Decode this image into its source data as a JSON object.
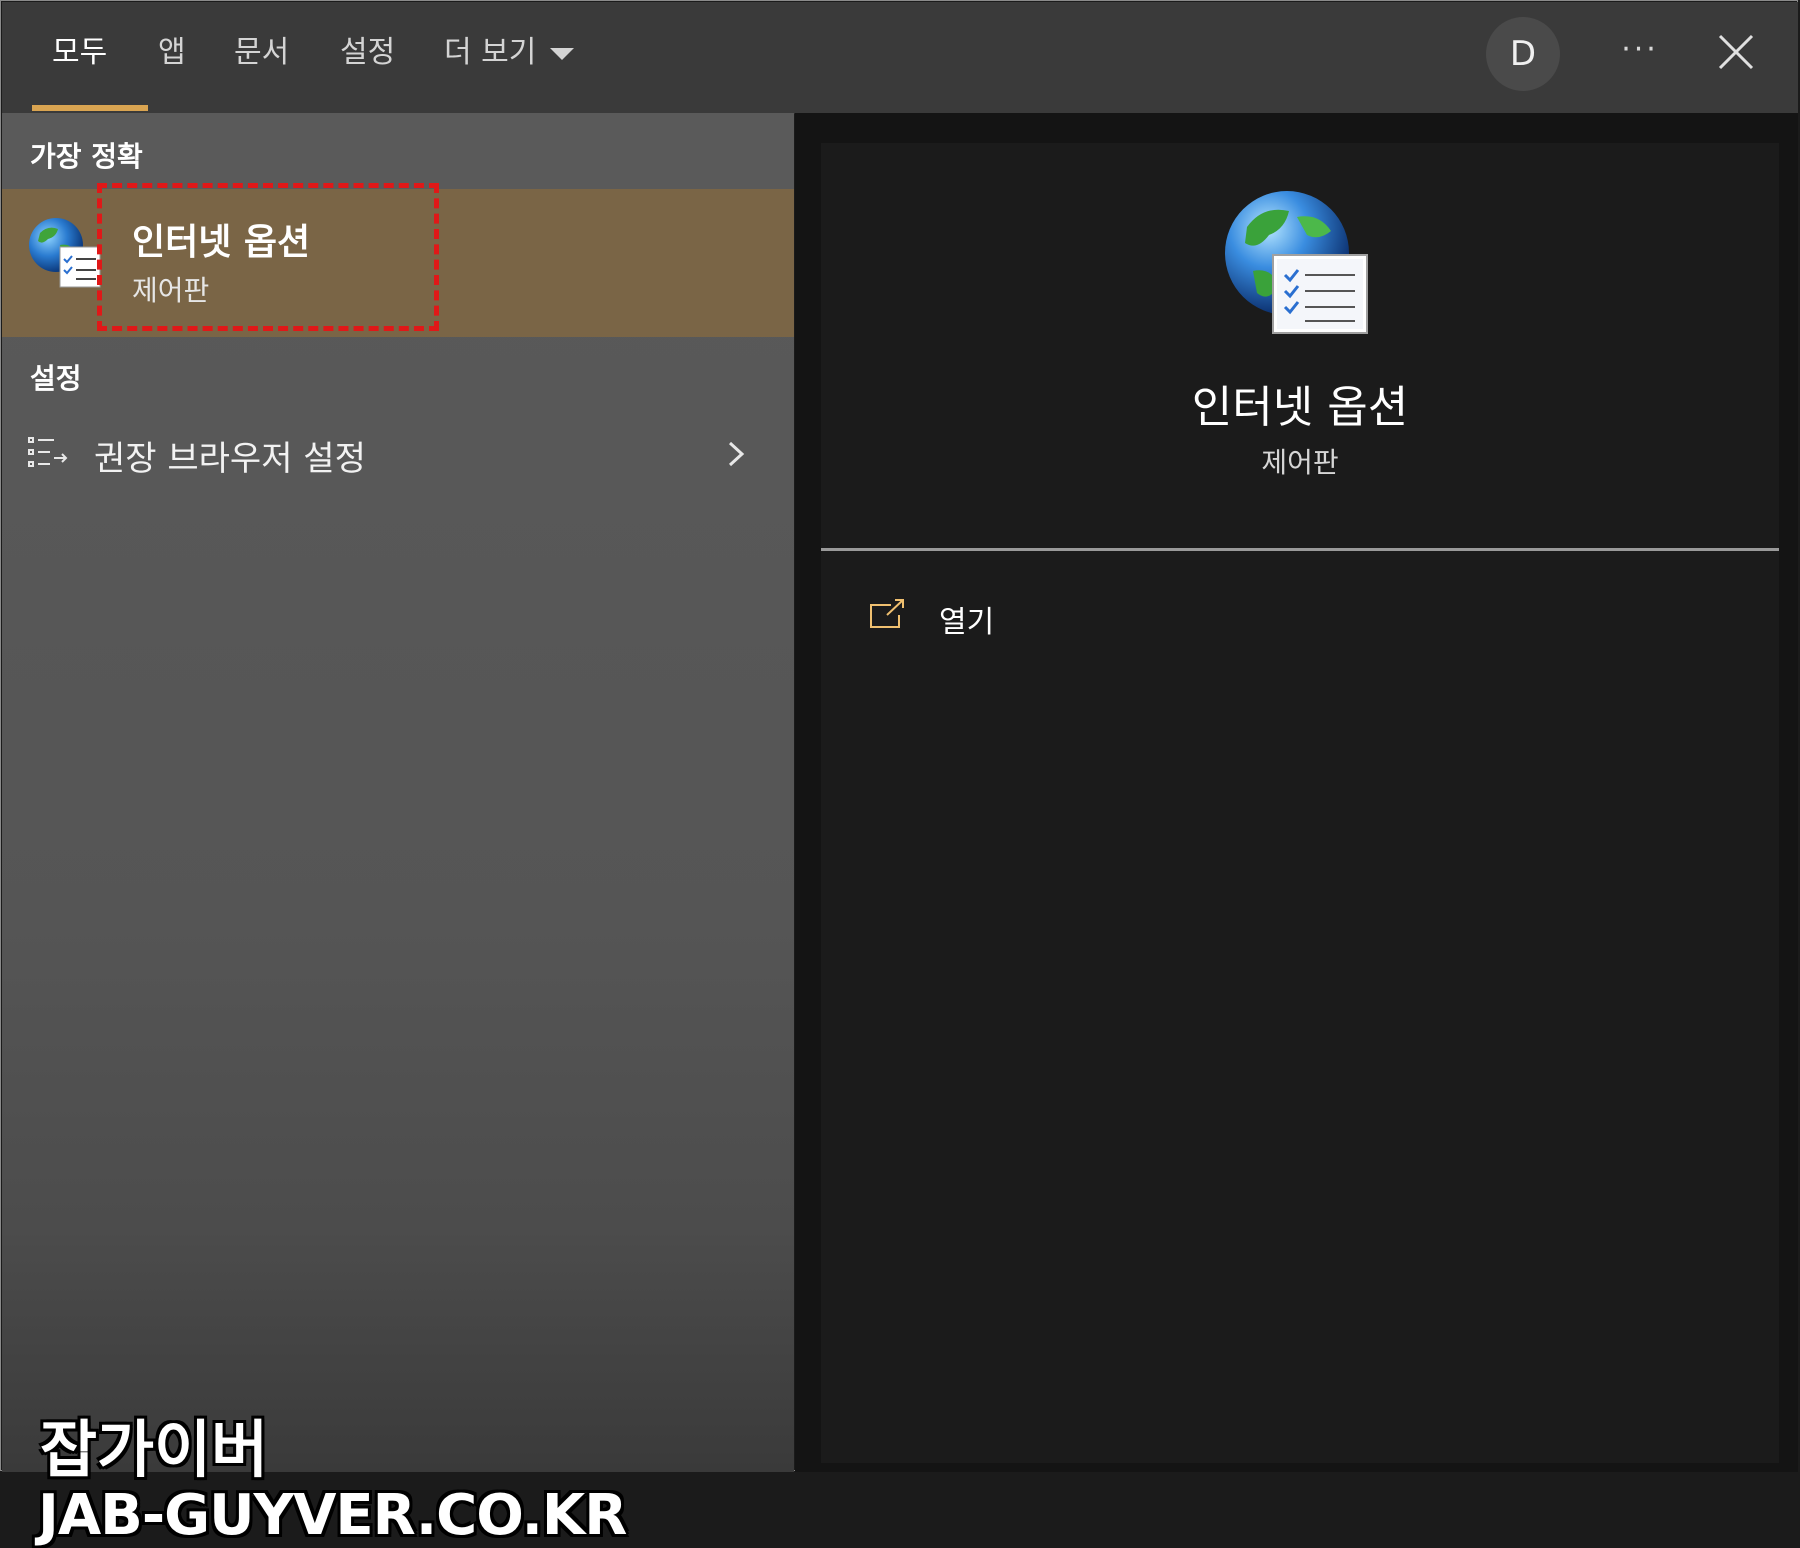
{
  "tabs": [
    {
      "label": "모두",
      "active": true
    },
    {
      "label": "앱",
      "active": false
    },
    {
      "label": "문서",
      "active": false
    },
    {
      "label": "설정",
      "active": false
    },
    {
      "label": "더 보기",
      "active": false
    }
  ],
  "header": {
    "avatar_letter": "D",
    "more_label": "···",
    "close_icon": "close-icon"
  },
  "best_match": {
    "header": "가장 정확",
    "title": "인터넷 옵션",
    "subtitle": "제어판",
    "icon": "internet-options-icon"
  },
  "settings": {
    "header": "설정",
    "items": [
      {
        "label": "권장 브라우저 설정",
        "icon": "browser-settings-icon"
      }
    ]
  },
  "detail": {
    "title": "인터넷 옵션",
    "subtitle": "제어판",
    "actions": [
      {
        "label": "열기",
        "icon": "open-icon"
      }
    ]
  },
  "watermark": {
    "korean": "잡가이버",
    "url": "JAB-GUYVER.CO.KR"
  },
  "colors": {
    "accent": "#d9a451",
    "selected_row": "#7a6546",
    "highlight_box": "#e01818",
    "right_pane": "#1b1b1b",
    "left_pane": "#5a5a5a"
  }
}
